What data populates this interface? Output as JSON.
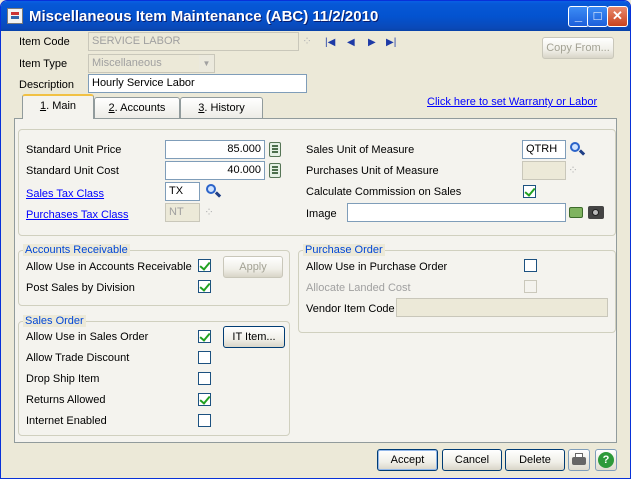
{
  "window": {
    "title": "Miscellaneous Item Maintenance (ABC) 11/2/2010",
    "minimize": "_",
    "maximize": "□",
    "close": "✕"
  },
  "header": {
    "item_code_label": "Item Code",
    "item_code_value": "SERVICE LABOR",
    "item_type_label": "Item Type",
    "item_type_value": "Miscellaneous",
    "description_label": "Description",
    "description_value": "Hourly Service Labor",
    "copy_from_label": "Copy From...",
    "warranty_link": "Click here to set Warranty or Labor"
  },
  "tabs": [
    {
      "num": "1",
      "label": ". Main"
    },
    {
      "num": "2",
      "label": ". Accounts"
    },
    {
      "num": "3",
      "label": ". History"
    }
  ],
  "main": {
    "std_price_label": "Standard Unit Price",
    "std_price_value": "85.000",
    "std_cost_label": "Standard Unit Cost",
    "std_cost_value": "40.000",
    "sales_tax_class_label": "Sales Tax Class",
    "sales_tax_class_value": "TX",
    "purch_tax_class_label": "Purchases Tax Class",
    "purch_tax_class_value": "NT",
    "sales_uom_label": "Sales Unit of Measure",
    "sales_uom_value": "QTRH",
    "purch_uom_label": "Purchases Unit of Measure",
    "purch_uom_value": "",
    "calc_commission_label": "Calculate Commission on Sales",
    "calc_commission_checked": true,
    "image_label": "Image",
    "image_value": ""
  },
  "ar": {
    "title": "Accounts Receivable",
    "allow_label": "Allow Use in Accounts Receivable",
    "allow_checked": true,
    "post_division_label": "Post Sales by Division",
    "post_division_checked": true,
    "apply_label": "Apply"
  },
  "po": {
    "title": "Purchase Order",
    "allow_label": "Allow Use in Purchase Order",
    "allow_checked": false,
    "landed_cost_label": "Allocate Landed Cost",
    "landed_cost_checked": false,
    "vendor_item_label": "Vendor Item Code",
    "vendor_item_value": ""
  },
  "so": {
    "title": "Sales Order",
    "allow_label": "Allow Use in Sales Order",
    "allow_checked": true,
    "trade_discount_label": "Allow Trade Discount",
    "trade_discount_checked": false,
    "drop_ship_label": "Drop Ship Item",
    "drop_ship_checked": false,
    "returns_label": "Returns Allowed",
    "returns_checked": true,
    "internet_label": "Internet Enabled",
    "internet_checked": false,
    "it_item_label": "IT Item..."
  },
  "footer": {
    "accept_label": "Accept",
    "cancel_label": "Cancel",
    "delete_label": "Delete"
  },
  "icons": [
    "window-icon",
    "lookup-icon",
    "first-record-icon",
    "previous-record-icon",
    "next-record-icon",
    "last-record-icon",
    "calculator-icon",
    "magnifier-icon",
    "folder-icon",
    "camera-icon",
    "printer-icon",
    "help-icon"
  ]
}
